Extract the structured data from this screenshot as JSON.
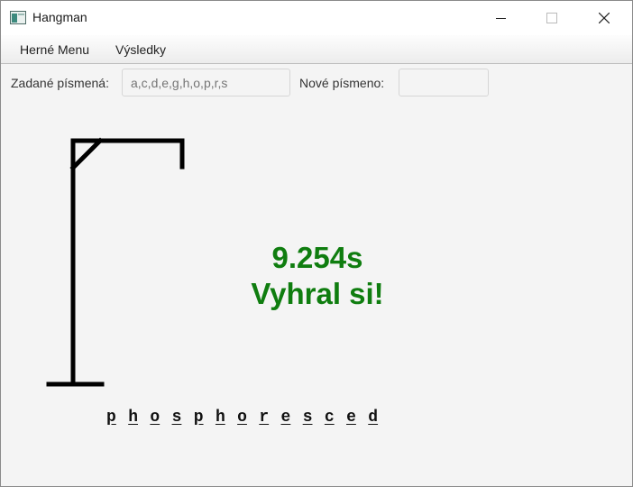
{
  "window": {
    "title": "Hangman",
    "app_icon": "java-app-icon",
    "controls": [
      "minimize-icon",
      "maximize-icon",
      "close-icon"
    ]
  },
  "menu": {
    "items": [
      {
        "label": "Herné Menu"
      },
      {
        "label": "Výsledky"
      }
    ]
  },
  "controls": {
    "entered_label": "Zadané písmená:",
    "entered_placeholder": "a,c,d,e,g,h,o,p,r,s",
    "new_label": "Nové písmeno:",
    "new_value": ""
  },
  "result": {
    "time": "9.254s",
    "message": "Vyhral si!",
    "color": "#0f7d0f"
  },
  "word": {
    "letters": [
      "p",
      "h",
      "o",
      "s",
      "p",
      "h",
      "o",
      "r",
      "e",
      "s",
      "c",
      "e",
      "d"
    ]
  }
}
